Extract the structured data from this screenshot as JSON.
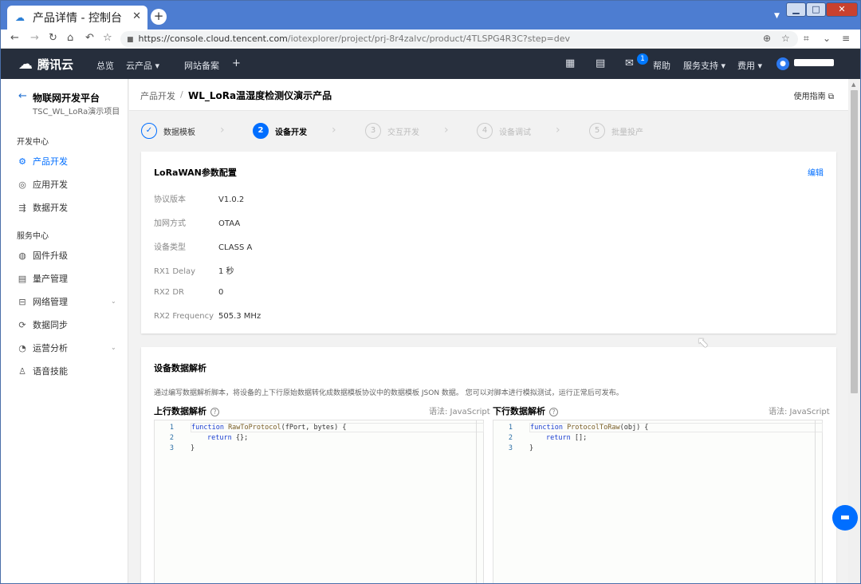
{
  "browser": {
    "tab_title": "产品详情 - 控制台",
    "tab_close": "✕",
    "new_tab": "+",
    "url": "https://console.cloud.tencent.com/iotexplorer/project/prj-8r4zalvc/product/4TLSPG4R3C?step=dev",
    "url_host": "https://console.cloud.tencent.com",
    "url_path": "/iotexplorer/project/prj-8r4zalvc/product/4TLSPG4R3C?step=dev"
  },
  "header": {
    "brand": "腾讯云",
    "nav": [
      "总览",
      "云产品 ▾",
      "网站备案",
      "+"
    ],
    "help": "帮助",
    "help_badge": "1",
    "support": "服务支持 ▾",
    "billing": "费用 ▾"
  },
  "sidebar": {
    "title": "物联网开发平台",
    "subtitle": "TSC_WL_LoRa演示项目",
    "section_dev": "开发中心",
    "dev_items": [
      "产品开发",
      "应用开发",
      "数据开发"
    ],
    "section_service": "服务中心",
    "service_items": [
      "固件升级",
      "量产管理",
      "网络管理",
      "数据同步",
      "运营分析",
      "语音技能"
    ]
  },
  "breadcrumb": {
    "parent": "产品开发",
    "separator": "/",
    "current": "WL_LoRa温湿度检测仪演示产品",
    "guide": "使用指南"
  },
  "steps": [
    {
      "num": "✓",
      "label": "数据模板",
      "state": "done"
    },
    {
      "num": "2",
      "label": "设备开发",
      "state": "current"
    },
    {
      "num": "3",
      "label": "交互开发",
      "state": "todo"
    },
    {
      "num": "4",
      "label": "设备调试",
      "state": "todo"
    },
    {
      "num": "5",
      "label": "批量投产",
      "state": "todo"
    }
  ],
  "lora_card": {
    "title": "LoRaWAN参数配置",
    "edit": "编辑",
    "params": [
      {
        "key": "协议版本",
        "value": "V1.0.2"
      },
      {
        "key": "加网方式",
        "value": "OTAA"
      },
      {
        "key": "设备类型",
        "value": "CLASS A"
      },
      {
        "key": "RX1 Delay",
        "value": "1 秒"
      },
      {
        "key": "RX2 DR",
        "value": "0"
      },
      {
        "key": "RX2 Frequency",
        "value": "505.3 MHz"
      }
    ]
  },
  "parse_card": {
    "title": "设备数据解析",
    "description": "通过编写数据解析脚本，将设备的上下行原始数据转化成数据模板协议中的数据模板 JSON 数据。 您可以对脚本进行模拟测试，运行正常后可发布。",
    "up_title": "上行数据解析",
    "down_title": "下行数据解析",
    "lang_label": "语法: JavaScript",
    "up_code": {
      "l1_kw": "function ",
      "l1_fn": "RawToProtocol",
      "l1_rest": "(fPort, bytes) {",
      "l2_kw": "return",
      "l2_rest": " {};",
      "l3": "}"
    },
    "down_code": {
      "l1_kw": "function ",
      "l1_fn": "ProtocolToRaw",
      "l1_rest": "(obj) {",
      "l2_kw": "return",
      "l2_rest": " [];",
      "l3": "}"
    },
    "line_numbers": [
      "1",
      "2",
      "3"
    ]
  }
}
